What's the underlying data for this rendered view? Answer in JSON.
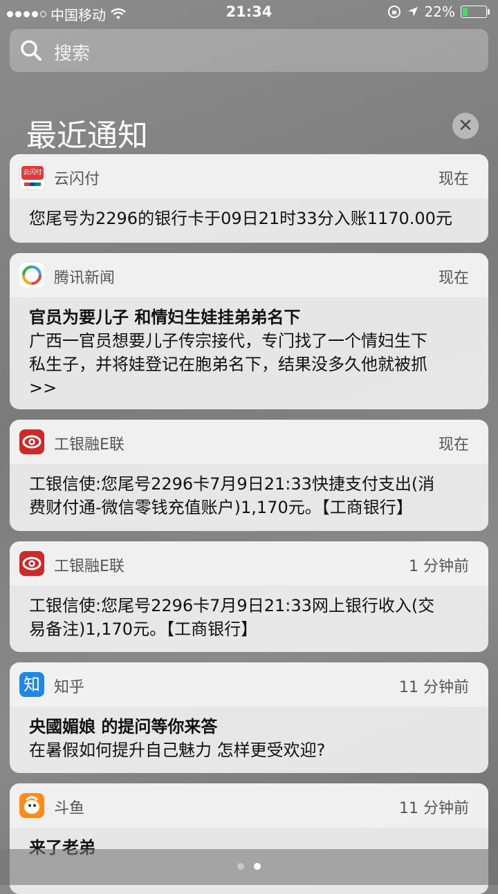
{
  "status": {
    "carrier": "中国移动",
    "time": "21:34",
    "battery": "22%",
    "battery_level": 0.22
  },
  "search": {
    "placeholder": "搜索"
  },
  "section": {
    "title": "最近通知",
    "clear_icon": "close-icon"
  },
  "notifications": [
    {
      "app": "云闪付",
      "time": "现在",
      "icon_color": "#e03a3a",
      "body_lines": [
        "您尾号为2296的银行卡于09日21时33分入账1170.00元"
      ]
    },
    {
      "app": "腾讯新闻",
      "time": "现在",
      "icon_color": "#ffffff",
      "title": "官员为要儿子 和情妇生娃挂弟弟名下",
      "body_lines": [
        "广西一官员想要儿子传宗接代，专门找了一个情妇生下",
        "私生子，并将娃登记在胞弟名下，结果没多久他就被抓",
        ">>"
      ]
    },
    {
      "app": "工银融E联",
      "time": "现在",
      "icon_color": "#cc2a2a",
      "body_lines": [
        "工银信使:您尾号2296卡7月9日21:33快捷支付支出(消",
        "费财付通-微信零钱充值账户)1,170元。【工商银行】"
      ]
    },
    {
      "app": "工银融E联",
      "time": "1 分钟前",
      "icon_color": "#cc2a2a",
      "body_lines": [
        "工银信使:您尾号2296卡7月9日21:33网上银行收入(交",
        "易备注)1,170元。【工商银行】"
      ]
    },
    {
      "app": "知乎",
      "time": "11 分钟前",
      "icon_color": "#1e88e5",
      "title": "央國媚娘 的提问等你来答",
      "body_lines": [
        "在暑假如何提升自己魅力 怎样更受欢迎?"
      ]
    },
    {
      "app": "斗鱼",
      "time": "11 分钟前",
      "icon_color": "#ff8c1a",
      "title": "来了老弟"
    }
  ],
  "pager": {
    "pages": 2,
    "active": 2
  }
}
